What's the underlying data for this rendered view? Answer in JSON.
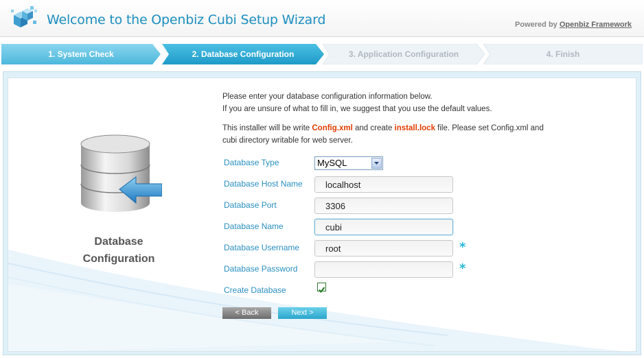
{
  "header": {
    "title": "Welcome to the Openbiz Cubi Setup Wizard",
    "powered_prefix": "Powered by",
    "powered_link": "Openbiz Framework"
  },
  "steps": [
    {
      "label": "1. System Check",
      "state": "done"
    },
    {
      "label": "2. Database Configuration",
      "state": "active"
    },
    {
      "label": "3. Application Configuration",
      "state": "pending"
    },
    {
      "label": "4. Finish",
      "state": "pending"
    }
  ],
  "sidebar": {
    "caption_line1": "Database",
    "caption_line2": "Configuration"
  },
  "intro": {
    "line1": "Please enter your database configuration information below.",
    "line2": "If you are unsure of what to fill in, we suggest that you use the default values.",
    "p2_a": "This installer will be write ",
    "p2_config": "Config.xml",
    "p2_b": " and create ",
    "p2_lock": "install.lock",
    "p2_c": " file. Please set Config.xml and",
    "p2_line2": "cubi directory writable for web server."
  },
  "form": {
    "db_type_label": "Database Type",
    "db_type_value": "MySQL",
    "host_label": "Database Host Name",
    "host_value": "localhost",
    "port_label": "Database Port",
    "port_value": "3306",
    "name_label": "Database Name",
    "name_value": "cubi",
    "user_label": "Database Username",
    "user_value": "root",
    "password_label": "Database Password",
    "password_value": "",
    "create_label": "Create Database",
    "create_checked": true,
    "required_mark": "*",
    "back_label": "< Back",
    "next_label": "Next >"
  },
  "colors": {
    "accent": "#2a8fc0",
    "step_active": "#2aa6cc",
    "step_done": "#5bc0de",
    "required": "#23b7d9",
    "highlight_red": "#e03c00"
  }
}
